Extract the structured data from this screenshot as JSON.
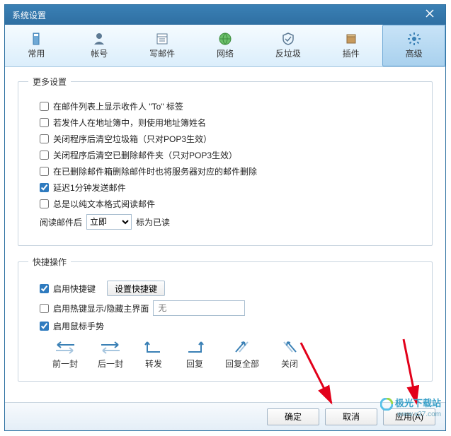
{
  "window": {
    "title": "系统设置"
  },
  "tabs": [
    {
      "label": "常用"
    },
    {
      "label": "帐号"
    },
    {
      "label": "写邮件"
    },
    {
      "label": "网络"
    },
    {
      "label": "反垃圾"
    },
    {
      "label": "插件"
    },
    {
      "label": "高级"
    }
  ],
  "sections": {
    "more": {
      "legend": "更多设置",
      "opts": [
        {
          "label": "在邮件列表上显示收件人 \"To\" 标签",
          "checked": false
        },
        {
          "label": "若发件人在地址簿中，则使用地址簿姓名",
          "checked": false
        },
        {
          "label": "关闭程序后清空垃圾箱（只对POP3生效）",
          "checked": false
        },
        {
          "label": "关闭程序后清空已删除邮件夹（只对POP3生效）",
          "checked": false
        },
        {
          "label": "在已删除邮件箱删除邮件时也将服务器对应的邮件删除",
          "checked": false
        },
        {
          "label": "延迟1分钟发送邮件",
          "checked": true
        },
        {
          "label": "总是以纯文本格式阅读邮件",
          "checked": false
        }
      ],
      "read_after_label": "阅读邮件后",
      "read_after_select": "立即",
      "read_after_suffix": "标为已读"
    },
    "quick": {
      "legend": "快捷操作",
      "enable_hotkey": {
        "label": "启用快捷键",
        "checked": true
      },
      "set_hotkey_btn": "设置快捷键",
      "toggle_main": {
        "label": "启用热键显示/隐藏主界面",
        "checked": false
      },
      "toggle_main_placeholder": "无",
      "enable_gesture": {
        "label": "启用鼠标手势",
        "checked": true
      },
      "gestures": [
        {
          "label": "前一封"
        },
        {
          "label": "后一封"
        },
        {
          "label": "转发"
        },
        {
          "label": "回复"
        },
        {
          "label": "回复全部"
        },
        {
          "label": "关闭"
        }
      ]
    }
  },
  "footer": {
    "ok": "确定",
    "cancel": "取消",
    "apply": "应用(A)"
  },
  "watermark": {
    "name": "极光下载站",
    "url": "www.x27.com"
  }
}
